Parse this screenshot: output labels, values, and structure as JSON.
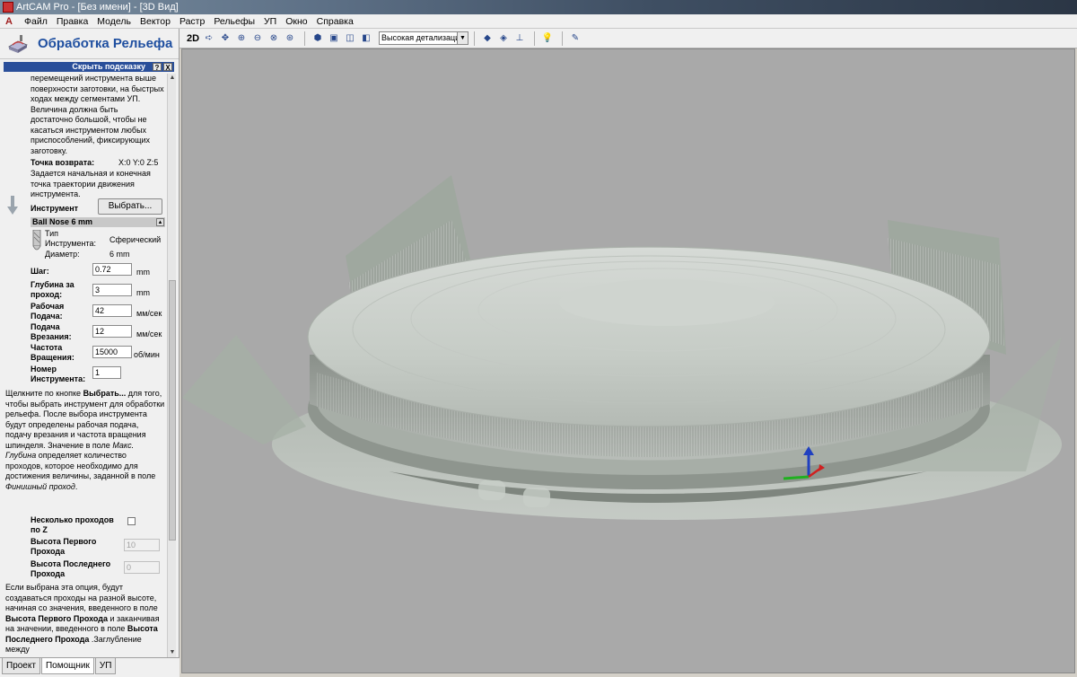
{
  "window": {
    "title": "ArtCAM Pro - [Без имени] - [3D Вид]"
  },
  "menu": {
    "items": [
      "Файл",
      "Правка",
      "Модель",
      "Вектор",
      "Растр",
      "Рельефы",
      "УП",
      "Окно",
      "Справка"
    ]
  },
  "panel": {
    "title": "Обработка Рельефа",
    "hint_label": "Скрыть подсказку",
    "hint_help": "?",
    "hint_close": "X",
    "intro_lines": [
      "перемещений инструмента выше",
      "поверхности заготовки, на быстрых",
      "ходах между сегментами УП.",
      "Величина должна быть",
      "достаточно большой, чтобы не",
      "касаться инструментом любых",
      "приспособлений, фиксирующих",
      "заготовку."
    ],
    "return_point_label": "Точка возврата:",
    "return_point_value": "X:0 Y:0 Z:5",
    "return_lines": [
      "Задается начальная и конечная",
      "точка траектории движения",
      "инструмента."
    ],
    "tool_label": "Инструмент",
    "select_button": "Выбрать...",
    "tool_name": "Ball Nose 6 mm",
    "tool_type_label": "Тип Инструмента:",
    "tool_type_value": "Сферический",
    "diameter_label": "Диаметр:",
    "diameter_value": "6 mm",
    "step_label": "Шаг:",
    "step_value": "0.72",
    "step_unit": "mm",
    "depth_label_1": "Глубина за",
    "depth_label_2": "проход:",
    "depth_value": "3",
    "depth_unit": "mm",
    "feed_label_1": "Рабочая",
    "feed_label_2": "Подача:",
    "feed_value": "42",
    "feed_unit": "мм/сек",
    "plunge_label_1": "Подача",
    "plunge_label_2": "Врезания:",
    "plunge_value": "12",
    "plunge_unit": "мм/сек",
    "spindle_label_1": "Частота",
    "spindle_label_2": "Вращения:",
    "spindle_value": "15000",
    "spindle_unit": "об/мин",
    "toolnum_label_1": "Номер",
    "toolnum_label_2": "Инструмента:",
    "toolnum_value": "1",
    "desc_html": "Щелкните по кнопке <b>Выбрать...</b> для того, чтобы выбрать инструмент для обработки рельефа. После выбора инструмента будут определены рабочая подача, подачу врезания и частота вращения шпинделя. Значение в поле <i>Макс. Глубина</i> определяет количество проходов, которое необходимо для достижения величины, заданной в поле <i>Финишный проход</i>.",
    "multi_z_label_1": "Несколько проходов",
    "multi_z_label_2": "по Z",
    "first_height_label_1": "Высота Первого",
    "first_height_label_2": "Прохода",
    "first_height_value": "10",
    "last_height_label_1": "Высота Последнего",
    "last_height_label_2": "Прохода",
    "last_height_value": "0",
    "tail_html": "Если выбрана эта опция, будут создаваться проходы на разной высоте, начиная со значения, введенного в поле <b>Высота Первого Прохода</b> и заканчивая на значении, введенного в поле <b>Высота Последнего Прохода</b> .Заглубление между"
  },
  "bottom_tabs": [
    "Проект",
    "Помощник",
    "УП"
  ],
  "toolbar": {
    "mode_2d": "2D",
    "detail": "Высокая детализация"
  },
  "colors": {
    "viewport_bg": "#a9a9a9",
    "panel_title": "#1f4fa0",
    "hint_bar": "#2a4f9a"
  }
}
